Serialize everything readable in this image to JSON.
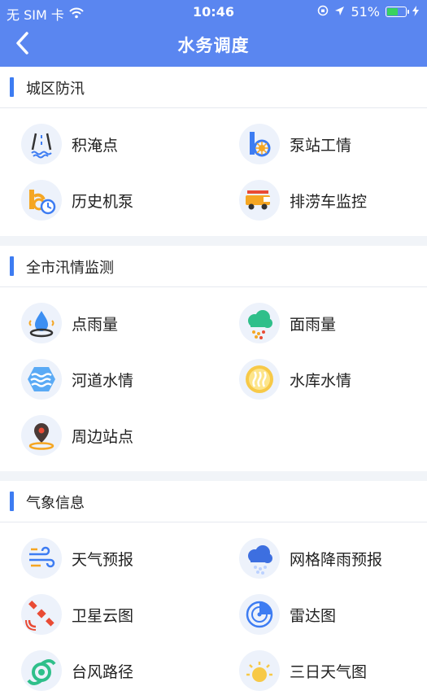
{
  "status": {
    "carrier": "无 SIM 卡",
    "time": "10:46",
    "battery": "51%"
  },
  "nav": {
    "title": "水务调度"
  },
  "sections": [
    {
      "title": "城区防汛",
      "items": [
        {
          "label": "积淹点",
          "icon": "road-flood-icon"
        },
        {
          "label": "泵站工情",
          "icon": "pump-station-icon"
        },
        {
          "label": "历史机泵",
          "icon": "history-pump-icon"
        },
        {
          "label": "排涝车监控",
          "icon": "drainage-truck-icon"
        }
      ]
    },
    {
      "title": "全市汛情监测",
      "items": [
        {
          "label": "点雨量",
          "icon": "water-drop-icon"
        },
        {
          "label": "面雨量",
          "icon": "rain-cloud-icon"
        },
        {
          "label": "河道水情",
          "icon": "river-wave-icon"
        },
        {
          "label": "水库水情",
          "icon": "reservoir-icon"
        },
        {
          "label": "周边站点",
          "icon": "location-pin-icon"
        }
      ]
    },
    {
      "title": "气象信息",
      "items": [
        {
          "label": "天气预报",
          "icon": "wind-icon"
        },
        {
          "label": "网格降雨预报",
          "icon": "grid-rain-icon"
        },
        {
          "label": "卫星云图",
          "icon": "satellite-icon"
        },
        {
          "label": "雷达图",
          "icon": "radar-icon"
        },
        {
          "label": "台风路径",
          "icon": "typhoon-icon"
        },
        {
          "label": "三日天气图",
          "icon": "sun-icon"
        }
      ]
    }
  ],
  "colors": {
    "header": "#5a86f0",
    "accent": "#3d7cf2",
    "divider": "#f1f4f8"
  }
}
